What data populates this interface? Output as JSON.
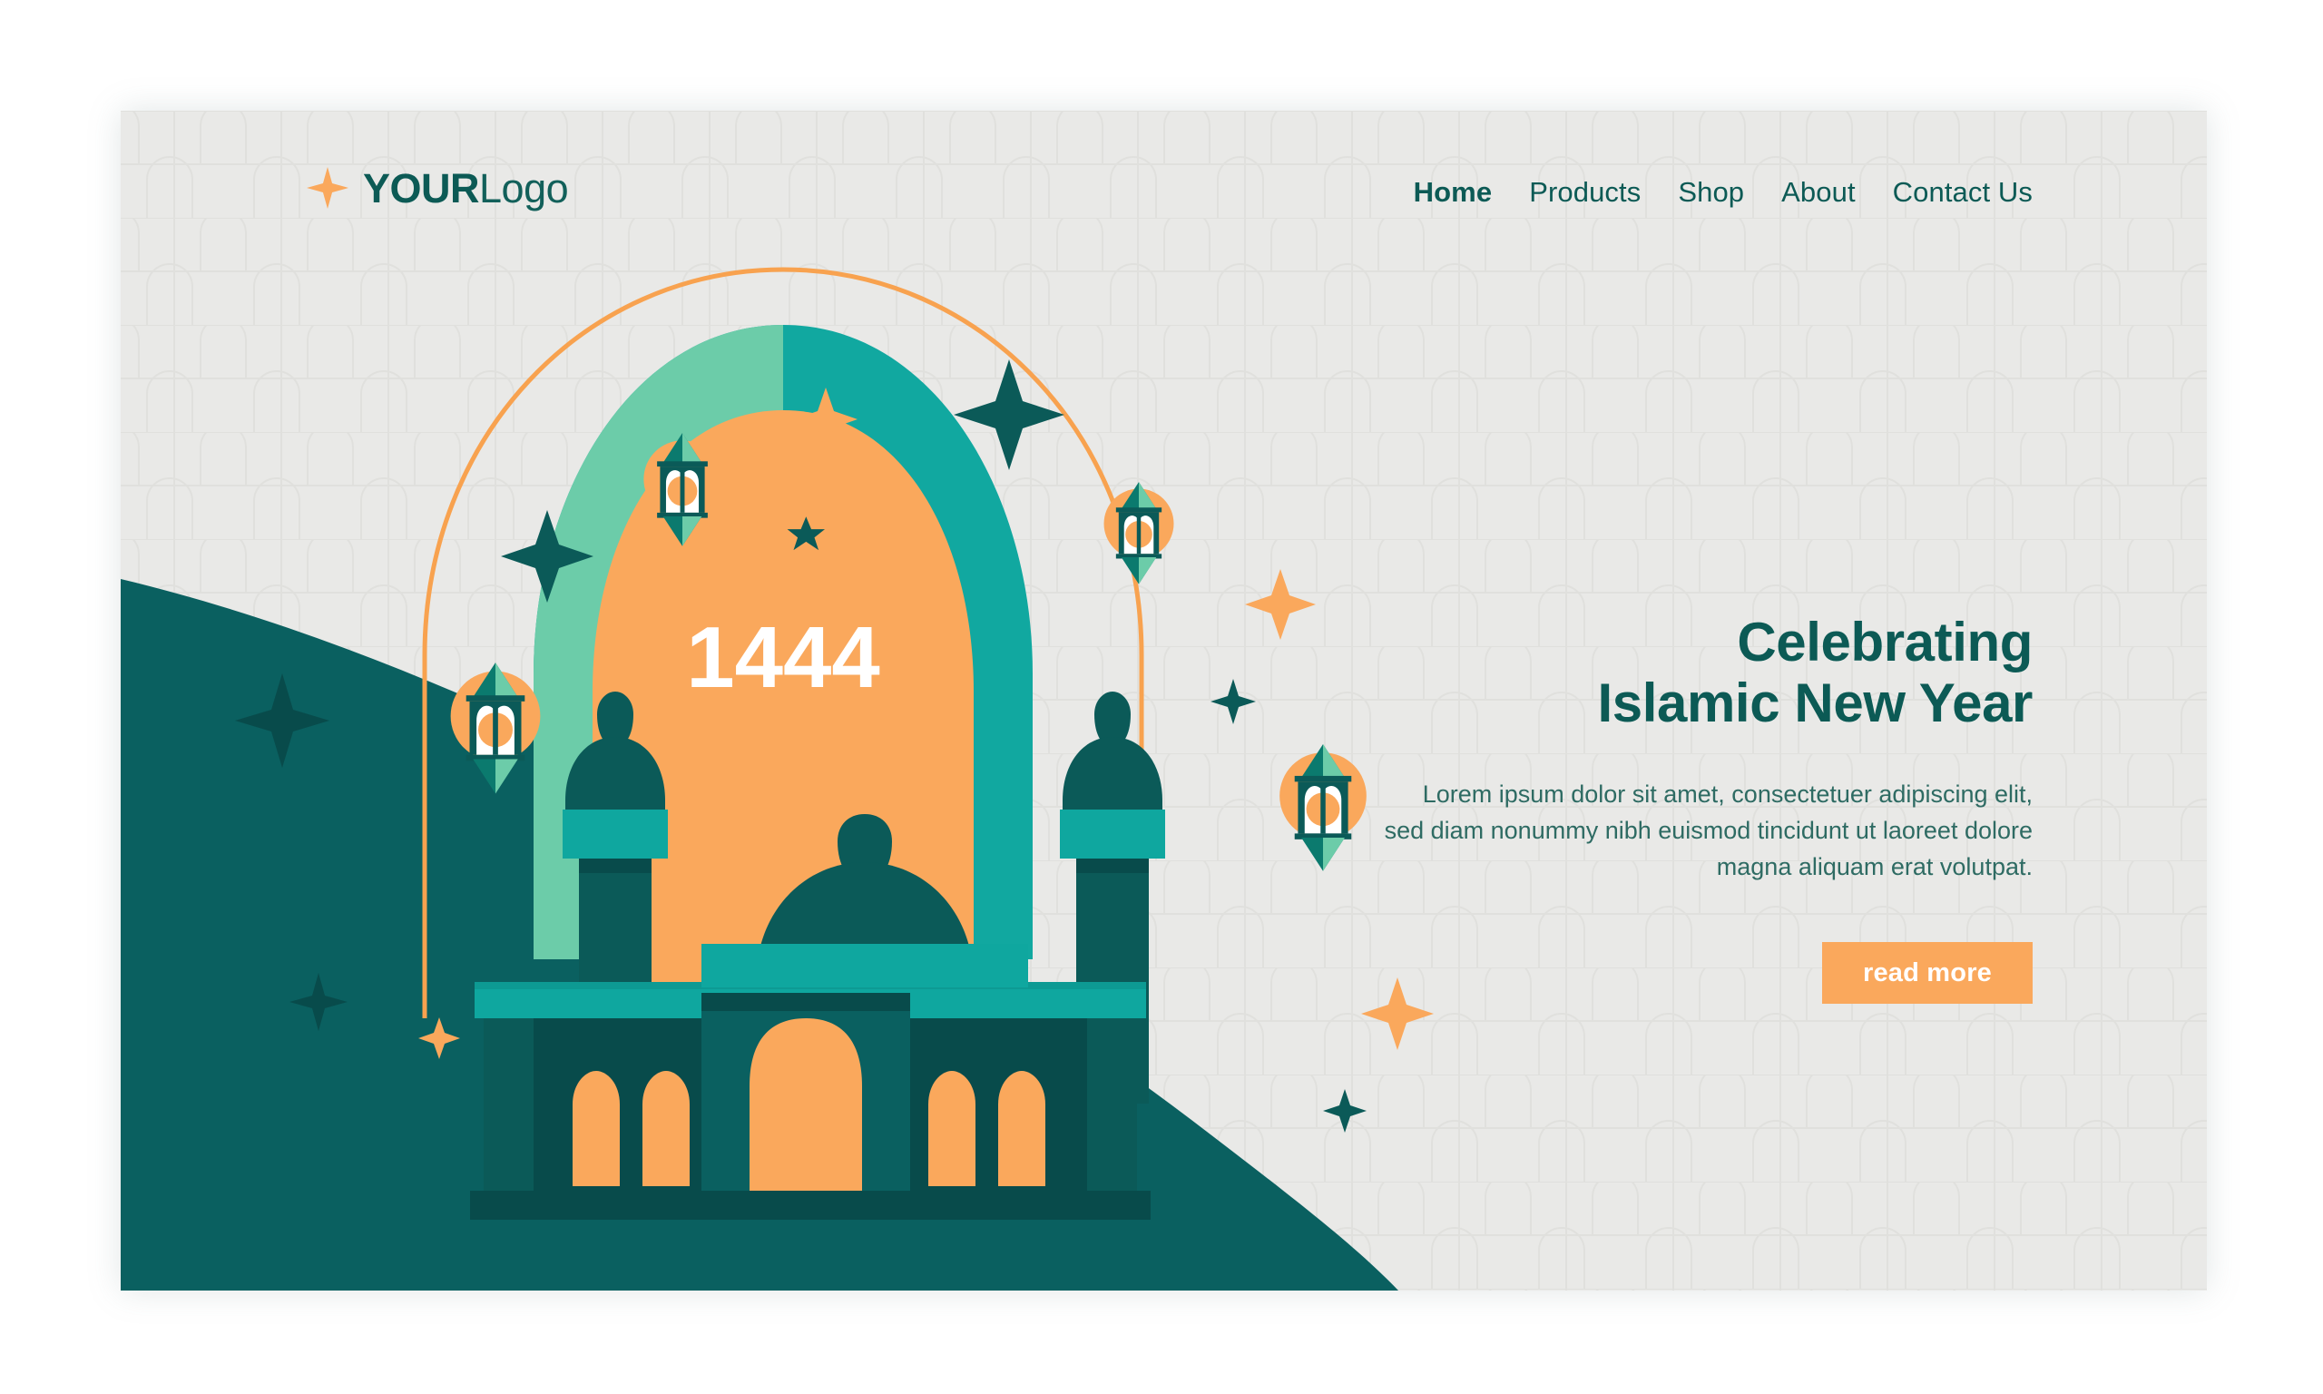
{
  "palette": {
    "card_bg": "#e9e9e7",
    "orange": "#faa85c",
    "orange_line": "#f8a24f",
    "teal": "#11a8a0",
    "teal_bright": "#0fa79f",
    "mint": "#6ccca9",
    "dark_teal": "#0b5a58",
    "deep_teal": "#0a6060",
    "darkest_teal": "#084b4b",
    "heading_teal": "#0c5a55",
    "body_teal": "#2e6b63",
    "white": "#ffffff"
  },
  "logo": {
    "icon": "four-point-star-icon",
    "bold_text": "YOUR",
    "light_text": "Logo"
  },
  "nav": {
    "items": [
      {
        "label": "Home",
        "active": true
      },
      {
        "label": "Products",
        "active": false
      },
      {
        "label": "Shop",
        "active": false
      },
      {
        "label": "About",
        "active": false
      },
      {
        "label": "Contact Us",
        "active": false
      }
    ]
  },
  "hero": {
    "title_line1": "Celebrating",
    "title_line2": "Islamic New Year",
    "body": "Lorem ipsum dolor sit amet, consectetuer adipiscing elit, sed diam nonummy nibh euismod tincidunt ut laoreet dolore magna aliquam erat volutpat.",
    "cta_label": "read more"
  },
  "illustration": {
    "year_label": "1444",
    "motifs": [
      "crescent-star-icon",
      "arch-outline",
      "mosque-dome",
      "minaret",
      "lantern-icon",
      "sparkle-star-icon"
    ],
    "lantern_count": 4,
    "sparkle_count": 9
  }
}
